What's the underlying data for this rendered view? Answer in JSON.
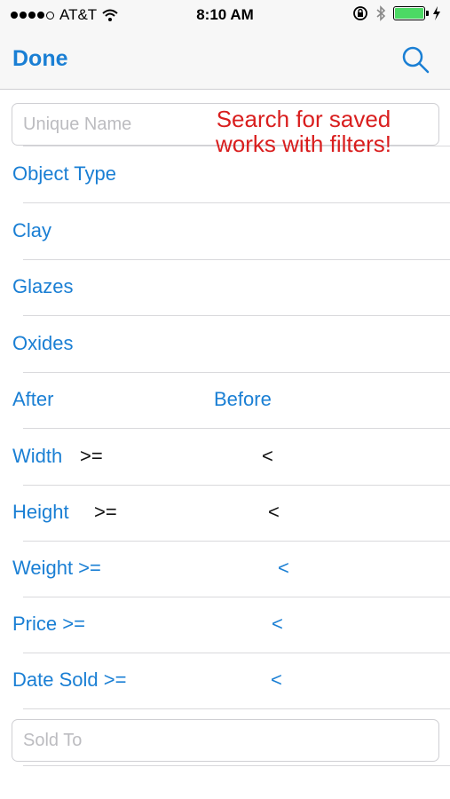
{
  "status": {
    "carrier": "AT&T",
    "time": "8:10 AM",
    "battery_color": "#4cd964"
  },
  "nav": {
    "done_label": "Done",
    "search_icon": "search-icon"
  },
  "search": {
    "unique_name_placeholder": "Unique Name",
    "sold_to_placeholder": "Sold To"
  },
  "annotation": {
    "line1": "Search for saved",
    "line2": "works with filters!"
  },
  "filters": {
    "object_type": "Object Type",
    "clay": "Clay",
    "glazes": "Glazes",
    "oxides": "Oxides",
    "after": "After",
    "before": "Before",
    "width": "Width",
    "width_gte": ">=",
    "width_lt": "<",
    "height": "Height",
    "height_gte": ">=",
    "height_lt": "<",
    "weight": "Weight >=",
    "weight_lt": "<",
    "price": "Price >=",
    "price_lt": "<",
    "date_sold": "Date Sold >=",
    "date_sold_lt": "<"
  },
  "colors": {
    "accent": "#1a7fd4",
    "annotation": "#d91e1e"
  }
}
